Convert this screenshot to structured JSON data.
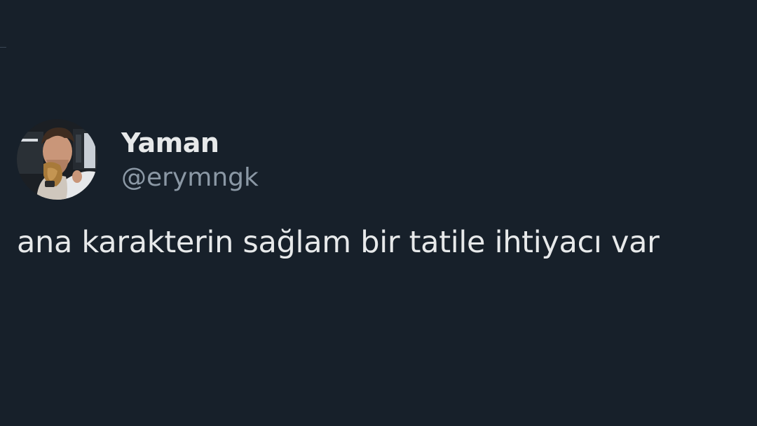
{
  "tweet": {
    "author": {
      "display_name": "Yaman",
      "handle": "@erymngk",
      "avatar_icon": "profile-photo"
    },
    "text": "ana karakterin sağlam bir tatile ihtiyacı var"
  },
  "colors": {
    "background": "#17202a",
    "primary_text": "#e7e9ea",
    "secondary_text": "#8b98a5"
  }
}
